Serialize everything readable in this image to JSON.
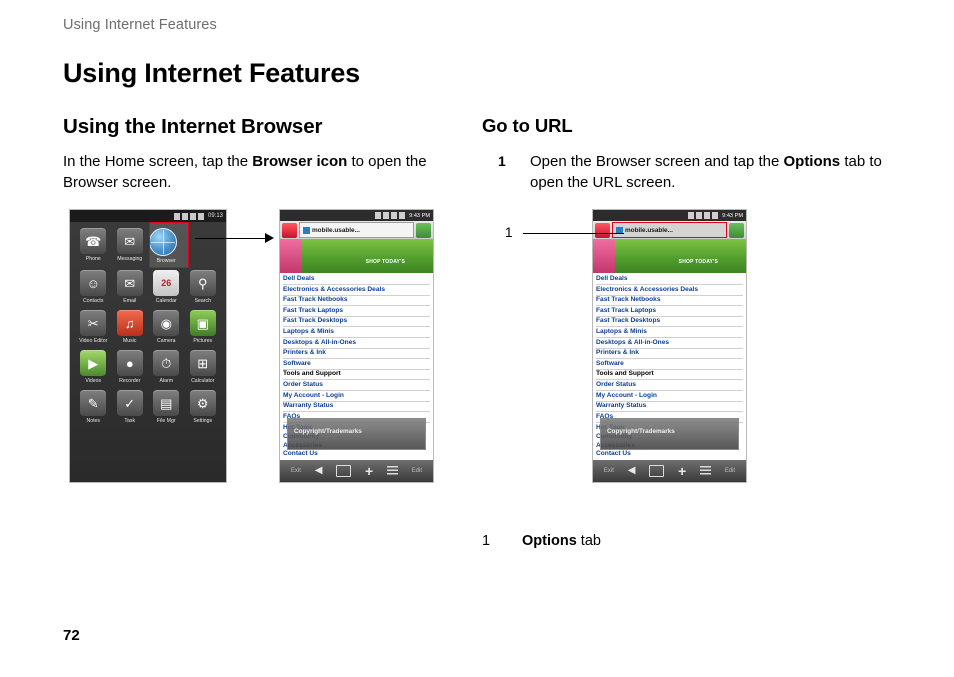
{
  "running_head": "Using Internet Features",
  "chapter_title": "Using Internet Features",
  "left_column": {
    "section_title": "Using the Internet Browser",
    "body_before": "In the Home screen, tap the ",
    "body_bold": "Browser icon",
    "body_after": " to open the Browser screen."
  },
  "right_column": {
    "section_title": "Go to URL",
    "steps": [
      {
        "num": "1",
        "text_1": "Open the Browser screen and tap the ",
        "bold": "Options",
        "text_2": " tab to open the URL screen."
      }
    ],
    "callout_number": "1",
    "caption_number": "1",
    "caption_bold": "Options",
    "caption_text": " tab"
  },
  "page_number": "72",
  "home_screen": {
    "status_time": "09:13",
    "apps": [
      {
        "label": "Phone",
        "glyph": "✆"
      },
      {
        "label": "Messaging",
        "glyph": "✉"
      },
      {
        "label": "Browser",
        "glyph": "globe"
      },
      {
        "label": "",
        "glyph": ""
      },
      {
        "label": "Contacts",
        "glyph": "☺"
      },
      {
        "label": "Email",
        "glyph": "✉"
      },
      {
        "label": "Calendar",
        "glyph": "26"
      },
      {
        "label": "Search",
        "glyph": "⚲"
      },
      {
        "label": "Video Editor",
        "glyph": "✂"
      },
      {
        "label": "Music",
        "glyph": "♫"
      },
      {
        "label": "Camera",
        "glyph": "◉"
      },
      {
        "label": "Pictures",
        "glyph": "▣"
      },
      {
        "label": "Videos",
        "glyph": "▶"
      },
      {
        "label": "Recorder",
        "glyph": "●"
      },
      {
        "label": "Alarm",
        "glyph": "⏱"
      },
      {
        "label": "Calculator",
        "glyph": "⊞"
      },
      {
        "label": "Notes",
        "glyph": "✎"
      },
      {
        "label": "Task",
        "glyph": "✓"
      },
      {
        "label": "File Mgr",
        "glyph": "▤"
      },
      {
        "label": "Settings",
        "glyph": "⚙"
      }
    ]
  },
  "browser_screen": {
    "status_time": "9:43 PM",
    "url_text": "mobile.usable...",
    "banner_text": "SHOP TODAY'S",
    "links_group_1": [
      "Dell Deals",
      "Electronics & Accessories Deals",
      "Fast Track Netbooks",
      "Fast Track Laptops",
      "Fast Track Desktops",
      "Laptops & Minis",
      "Desktops & All-in-Ones",
      "Printers & Ink",
      "Software"
    ],
    "links_group_2_heading": "Tools and Support",
    "links_group_2": [
      "Order Status",
      "My Account - Login",
      "Warranty Status",
      "FAQs"
    ],
    "overlay_text": "Copyright/Trademarks",
    "links_group_3": [
      "Hot Topic",
      "Community",
      "Accessories",
      "Contact Us"
    ],
    "toolbar": {
      "back": "◀",
      "window": "window-icon",
      "add": "+",
      "menu": "menu-icon",
      "label": "Exit",
      "label_right": "Edit"
    }
  }
}
